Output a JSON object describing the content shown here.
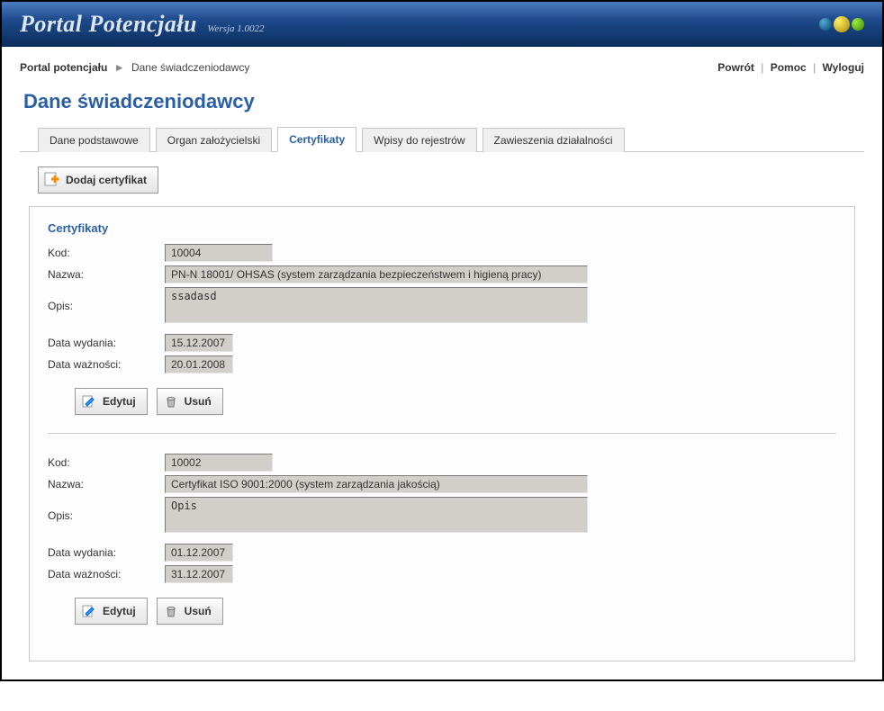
{
  "header": {
    "title": "Portal Potencjału",
    "subtitle": "Wersja 1.0022"
  },
  "breadcrumb": {
    "root": "Portal potencjału",
    "leaf": "Dane świadczeniodawcy"
  },
  "top_links": {
    "back": "Powrót",
    "help": "Pomoc",
    "logout": "Wyloguj"
  },
  "page_title": "Dane świadczeniodawcy",
  "tabs": {
    "t0": "Dane podstawowe",
    "t1": "Organ założycielski",
    "t2": "Certyfikaty",
    "t3": "Wpisy do rejestrów",
    "t4": "Zawieszenia działalności"
  },
  "buttons": {
    "add_cert": "Dodaj certyfikat",
    "edit": "Edytuj",
    "delete": "Usuń"
  },
  "panel_title": "Certyfikaty",
  "labels": {
    "kod": "Kod:",
    "nazwa": "Nazwa:",
    "opis": "Opis:",
    "data_wyd": "Data wydania:",
    "data_waz": "Data ważności:"
  },
  "certs": {
    "0": {
      "kod": "10004",
      "nazwa": "PN-N 18001/ OHSAS (system zarządzania bezpieczeństwem i higieną pracy)",
      "opis": "ssadasd",
      "data_wyd": "15.12.2007",
      "data_waz": "20.01.2008"
    },
    "1": {
      "kod": "10002",
      "nazwa": "Certyfikat ISO 9001:2000 (system zarządzania jakością)",
      "opis": "Opis",
      "data_wyd": "01.12.2007",
      "data_waz": "31.12.2007"
    }
  }
}
